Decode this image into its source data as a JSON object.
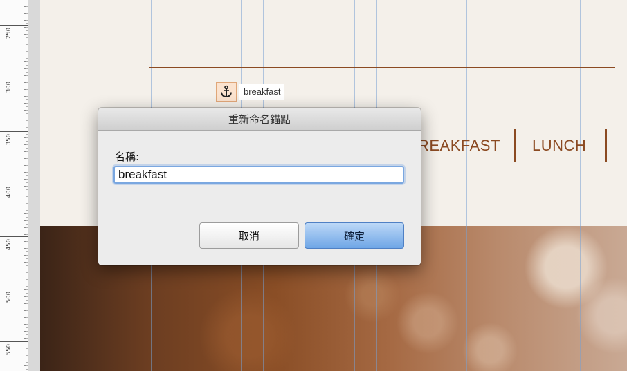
{
  "ruler": {
    "labels": [
      "250",
      "300",
      "350",
      "400",
      "450",
      "500",
      "550"
    ]
  },
  "page": {
    "nav": {
      "item1": "REAKFAST",
      "item2": "LUNCH"
    },
    "anchor": {
      "icon": "anchor-icon",
      "label": "breakfast"
    },
    "colors": {
      "accent": "#8b4a22",
      "guide": "#78a0d2"
    }
  },
  "dialog": {
    "title": "重新命名錨點",
    "name_label": "名稱:",
    "name_value": "breakfast",
    "cancel_label": "取消",
    "ok_label": "確定"
  }
}
